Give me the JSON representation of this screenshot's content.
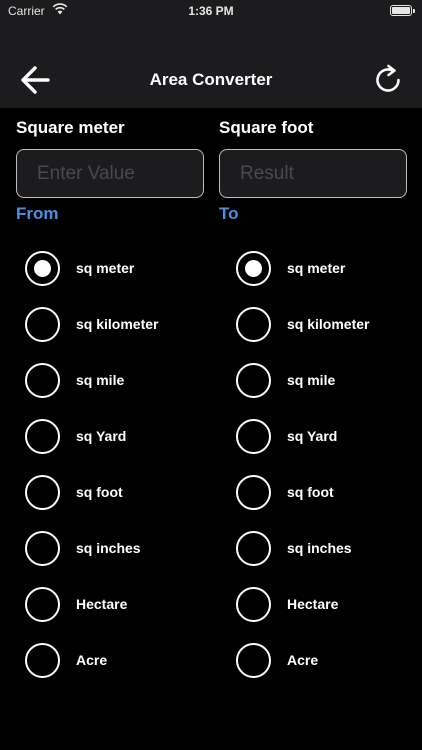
{
  "status": {
    "carrier": "Carrier",
    "time": "1:36 PM"
  },
  "header": {
    "title": "Area Converter"
  },
  "from": {
    "unit_label": "Square meter",
    "input_value": "",
    "input_placeholder": "Enter Value",
    "section_label": "From",
    "selected": "sq meter",
    "options": [
      "sq meter",
      "sq kilometer",
      "sq mile",
      "sq Yard",
      "sq foot",
      "sq inches",
      "Hectare",
      "Acre"
    ]
  },
  "to": {
    "unit_label": "Square foot",
    "result_value": "",
    "result_placeholder": "Result",
    "section_label": "To",
    "selected": "sq meter",
    "options": [
      "sq meter",
      "sq kilometer",
      "sq mile",
      "sq Yard",
      "sq foot",
      "sq inches",
      "Hectare",
      "Acre"
    ]
  },
  "colors": {
    "accent": "#4a90e2",
    "header_bg": "#1c1c1e",
    "background": "#000000"
  }
}
